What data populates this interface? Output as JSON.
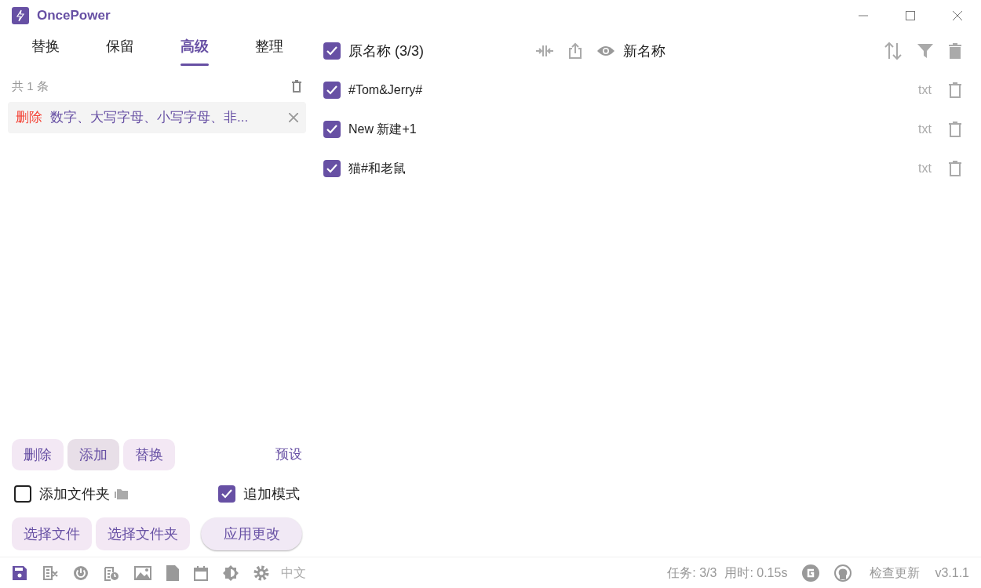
{
  "window": {
    "title": "OncePower"
  },
  "tabs": [
    {
      "label": "替换",
      "selected": false
    },
    {
      "label": "保留",
      "selected": false
    },
    {
      "label": "高级",
      "selected": true
    },
    {
      "label": "整理",
      "selected": false
    }
  ],
  "rules": {
    "count": "共 1 条",
    "items": [
      {
        "action": "删除",
        "description": "数字、大写字母、小写字母、非..."
      }
    ]
  },
  "rule_buttons": [
    {
      "label": "删除",
      "hovered": false
    },
    {
      "label": "添加",
      "hovered": true
    },
    {
      "label": "替换",
      "hovered": false
    }
  ],
  "preset_link": "预设",
  "options": [
    {
      "label": "添加文件夹",
      "checked": false,
      "kind": "folder"
    },
    {
      "label": "追加模式",
      "checked": true,
      "kind": "plain"
    }
  ],
  "file_buttons": [
    "选择文件",
    "选择文件夹"
  ],
  "apply_button": "应用更改",
  "file_list": {
    "all_checked": true,
    "original_header": "原名称 (3/3)",
    "new_header": "新名称",
    "files": [
      {
        "name": "#Tom&Jerry#",
        "ext": "txt",
        "checked": true
      },
      {
        "name": "New 新建+1",
        "ext": "txt",
        "checked": true
      },
      {
        "name": "猫#和老鼠",
        "ext": "txt",
        "checked": true
      }
    ]
  },
  "status_bar": {
    "language": "中文",
    "tasks": "任务: 3/3",
    "elapsed": "用时: 0.15s",
    "check_update": "检查更新",
    "version": "v3.1.1"
  }
}
